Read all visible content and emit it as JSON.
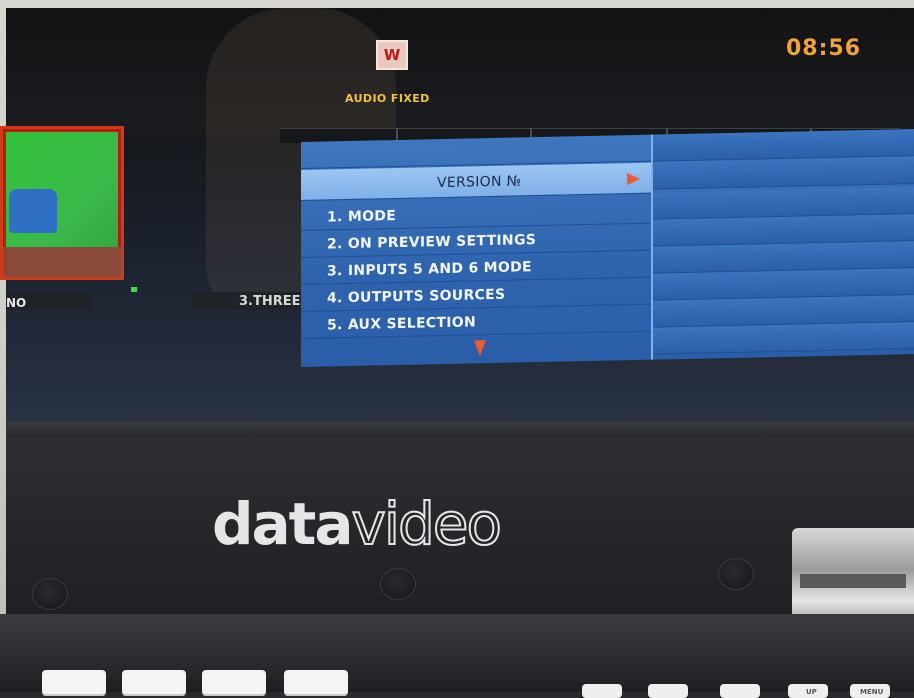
{
  "screen": {
    "input_badge": "W",
    "audio_status": "AUDIO FIXED",
    "clock": "08:56",
    "preview_labels": {
      "left": "NO",
      "right": "3.THREE"
    }
  },
  "menu": {
    "header": "VERSION №",
    "items": [
      {
        "label": "1. MODE"
      },
      {
        "label": "2. ON PREVIEW  SETTINGS"
      },
      {
        "label": "3. INPUTS 5 AND 6 MODE"
      },
      {
        "label": "4. OUTPUTS SOURCES"
      },
      {
        "label": "5. AUX SELECTION"
      }
    ],
    "icons": {
      "header_arrow": "triangle-right-icon",
      "scroll_arrow": "triangle-down-icon"
    }
  },
  "device": {
    "brand_bold": "data",
    "brand_thin": "video",
    "key_labels": [
      "UP",
      "MENU"
    ]
  },
  "colors": {
    "menu_blue": "#2e63ad",
    "menu_header": "#9cc6f2",
    "accent_orange": "#ef5a2e",
    "clock_orange": "#f2a23a",
    "audio_yellow": "#f0c23a",
    "tally_red": "#d23a1a"
  }
}
